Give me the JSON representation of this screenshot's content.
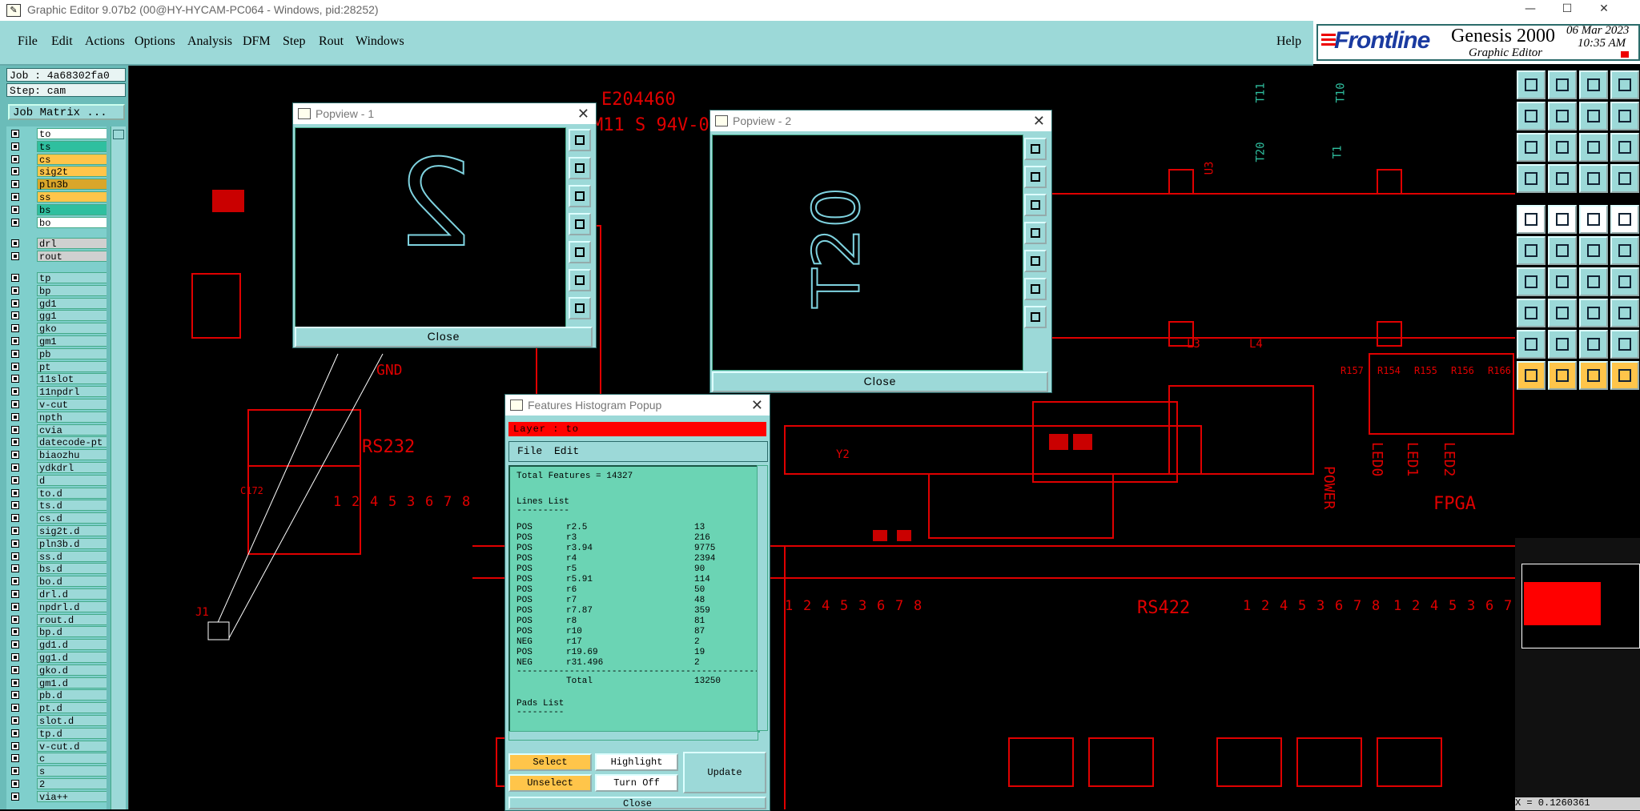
{
  "window": {
    "title": "Graphic Editor 9.07b2 (00@HY-HYCAM-PC064 - Windows, pid:28252)",
    "minimize": "—",
    "maximize": "☐",
    "close": "✕"
  },
  "menu": {
    "items": [
      "File",
      "Edit",
      "Actions",
      "Options",
      "Analysis",
      "DFM",
      "Step",
      "Rout",
      "Windows"
    ],
    "help": "Help"
  },
  "brand": {
    "logo": "Frontline",
    "product": "Genesis 2000",
    "subtitle": "Graphic Editor",
    "date": "06 Mar 2023",
    "time": "10:35 AM"
  },
  "left": {
    "job": "Job : 4a68302fa0",
    "step": "Step: cam",
    "job_matrix": "Job Matrix ..."
  },
  "layers": [
    {
      "name": "to",
      "color": "#ffffff"
    },
    {
      "name": "ts",
      "color": "#2fbf9f"
    },
    {
      "name": "cs",
      "color": "#ffc54a"
    },
    {
      "name": "sig2t",
      "color": "#ffc54a"
    },
    {
      "name": "pln3b",
      "color": "#d9a62a"
    },
    {
      "name": "ss",
      "color": "#ffc54a"
    },
    {
      "name": "bs",
      "color": "#2fbf9f"
    },
    {
      "name": "bo",
      "color": "#ffffff"
    },
    {
      "name": "drl",
      "color": "#d0d0d0"
    },
    {
      "name": "rout",
      "color": "#d0d0d0"
    },
    {
      "name": "tp",
      "color": "#9cd9d8"
    },
    {
      "name": "bp",
      "color": "#9cd9d8"
    },
    {
      "name": "gd1",
      "color": "#9cd9d8"
    },
    {
      "name": "gg1",
      "color": "#9cd9d8"
    },
    {
      "name": "gko",
      "color": "#9cd9d8"
    },
    {
      "name": "gm1",
      "color": "#9cd9d8"
    },
    {
      "name": "pb",
      "color": "#9cd9d8"
    },
    {
      "name": "pt",
      "color": "#9cd9d8"
    },
    {
      "name": "11slot",
      "color": "#9cd9d8"
    },
    {
      "name": "11npdrl",
      "color": "#9cd9d8"
    },
    {
      "name": "v-cut",
      "color": "#9cd9d8"
    },
    {
      "name": "npth",
      "color": "#9cd9d8"
    },
    {
      "name": "cvia",
      "color": "#9cd9d8"
    },
    {
      "name": "datecode-pt",
      "color": "#9cd9d8"
    },
    {
      "name": "biaozhu",
      "color": "#9cd9d8"
    },
    {
      "name": "ydkdrl",
      "color": "#9cd9d8"
    },
    {
      "name": "d",
      "color": "#9cd9d8"
    },
    {
      "name": "to.d",
      "color": "#9cd9d8"
    },
    {
      "name": "ts.d",
      "color": "#9cd9d8"
    },
    {
      "name": "cs.d",
      "color": "#9cd9d8"
    },
    {
      "name": "sig2t.d",
      "color": "#9cd9d8"
    },
    {
      "name": "pln3b.d",
      "color": "#9cd9d8"
    },
    {
      "name": "ss.d",
      "color": "#9cd9d8"
    },
    {
      "name": "bs.d",
      "color": "#9cd9d8"
    },
    {
      "name": "bo.d",
      "color": "#9cd9d8"
    },
    {
      "name": "drl.d",
      "color": "#9cd9d8"
    },
    {
      "name": "npdrl.d",
      "color": "#9cd9d8"
    },
    {
      "name": "rout.d",
      "color": "#9cd9d8"
    },
    {
      "name": "bp.d",
      "color": "#9cd9d8"
    },
    {
      "name": "gd1.d",
      "color": "#9cd9d8"
    },
    {
      "name": "gg1.d",
      "color": "#9cd9d8"
    },
    {
      "name": "gko.d",
      "color": "#9cd9d8"
    },
    {
      "name": "gm1.d",
      "color": "#9cd9d8"
    },
    {
      "name": "pb.d",
      "color": "#9cd9d8"
    },
    {
      "name": "pt.d",
      "color": "#9cd9d8"
    },
    {
      "name": "slot.d",
      "color": "#9cd9d8"
    },
    {
      "name": "tp.d",
      "color": "#9cd9d8"
    },
    {
      "name": "v-cut.d",
      "color": "#9cd9d8"
    },
    {
      "name": "c",
      "color": "#9cd9d8"
    },
    {
      "name": "s",
      "color": "#9cd9d8"
    },
    {
      "name": "2",
      "color": "#9cd9d8"
    },
    {
      "name": "via++",
      "color": "#9cd9d8"
    }
  ],
  "popview1": {
    "title": "Popview - 1",
    "glyph": "2",
    "close": "Close"
  },
  "popview2": {
    "title": "Popview - 2",
    "glyph": "T20",
    "close": "Close"
  },
  "histogram": {
    "title": "Features Histogram Popup",
    "layer": "Layer :  to",
    "menu": [
      "File",
      "Edit"
    ],
    "total": "Total Features = 14327",
    "lines_header": "Lines List",
    "rows": [
      [
        "POS",
        "r2.5",
        "13"
      ],
      [
        "POS",
        "r3",
        "216"
      ],
      [
        "POS",
        "r3.94",
        "9775"
      ],
      [
        "POS",
        "r4",
        "2394"
      ],
      [
        "POS",
        "r5",
        "90"
      ],
      [
        "POS",
        "r5.91",
        "114"
      ],
      [
        "POS",
        "r6",
        "50"
      ],
      [
        "POS",
        "r7",
        "48"
      ],
      [
        "POS",
        "r7.87",
        "359"
      ],
      [
        "POS",
        "r8",
        "81"
      ],
      [
        "POS",
        "r10",
        "87"
      ],
      [
        "NEG",
        "r17",
        "2"
      ],
      [
        "POS",
        "r19.69",
        "19"
      ],
      [
        "NEG",
        "r31.496",
        "2"
      ]
    ],
    "total_label": "Total",
    "total_value": "13250",
    "pads_header": "Pads List",
    "buttons": {
      "select": "Select",
      "highlight": "Highlight",
      "unselect": "Unselect",
      "turn_off": "Turn Off",
      "update": "Update",
      "close": "Close"
    }
  },
  "canvas": {
    "labels": [
      "E204460",
      "M11 S 94V-0",
      "GND",
      "RS232",
      "RS422",
      "FPGA",
      "POWER",
      "LED0",
      "LED1",
      "LED2",
      "J1",
      "T11",
      "T10",
      "T20",
      "T1",
      "U3",
      "Y2",
      "L3",
      "L4",
      "R157",
      "R154",
      "R155",
      "R156",
      "R166",
      "C172"
    ],
    "pins": [
      "1",
      "2",
      "4",
      "5",
      "3",
      "6",
      "7",
      "8"
    ]
  },
  "status": {
    "coord": "X = 0.1260361"
  },
  "colors": {
    "accent": "#9cd9d8",
    "pcb": "#e00000",
    "highlight": "#ff0000"
  }
}
